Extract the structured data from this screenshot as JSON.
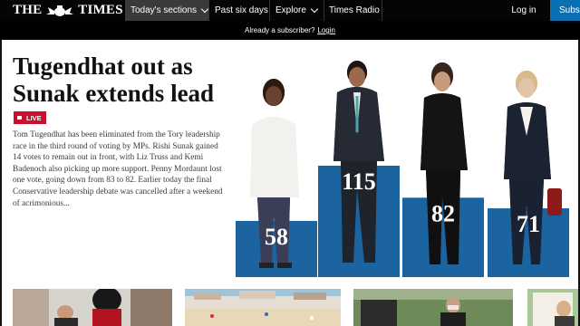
{
  "nav": {
    "logo_left": "THE",
    "logo_right": "TIMES",
    "items": [
      {
        "label": "Today's sections"
      },
      {
        "label": "Past six days"
      },
      {
        "label": "Explore"
      },
      {
        "label": "Times Radio"
      }
    ],
    "login": "Log in",
    "subscribe": "Subscribe"
  },
  "subscriber_bar": {
    "text": "Already a subscriber?",
    "link": "Login"
  },
  "article": {
    "headline": "Tugendhat out as Sunak extends lead",
    "badge": "LIVE",
    "summary": "Tom Tugendhat has been eliminated from the Tory leadership race in the third round of voting by MPs. Rishi Sunak gained 14 votes to remain out in front, with Liz Truss and Kemi Badenoch also picking up more support. Penny Mordaunt lost one vote, going down from 83 to 82. Earlier today the final Conservative leadership debate was cancelled after a weekend of acrimonious..."
  },
  "chart_data": {
    "type": "bar",
    "categories": [
      "",
      "",
      "",
      ""
    ],
    "values": [
      58,
      115,
      82,
      71
    ],
    "value_labels": [
      "58",
      "115",
      "82",
      "71"
    ]
  },
  "colors": {
    "nav_bg": "#050505",
    "active_tab": "#3a3a3a",
    "subscribe": "#0a6fb3",
    "live": "#c8102e",
    "bar": "#1c64a0"
  }
}
